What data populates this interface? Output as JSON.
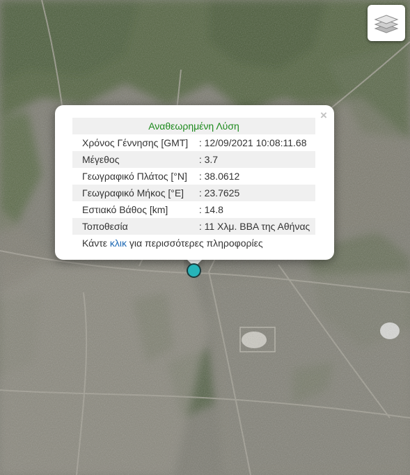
{
  "map": {
    "layers_control": {
      "icon": "layers-icon"
    }
  },
  "popup": {
    "title": "Αναθεωρημένη Λύση",
    "close_label": "×",
    "rows": [
      {
        "label": "Χρόνος Γέννησης [GMT]",
        "value": ": 12/09/2021 10:08:11.68"
      },
      {
        "label": "Μέγεθος",
        "value": ": 3.7"
      },
      {
        "label": "Γεωγραφικό Πλάτος [°N]",
        "value": ": 38.0612"
      },
      {
        "label": "Γεωγραφικό Μήκος [°E]",
        "value": ": 23.7625"
      },
      {
        "label": "Εστιακό Βάθος [km]",
        "value": ": 14.8"
      },
      {
        "label": "Τοποθεσία",
        "value": ": 11 Χλμ. ΒΒΑ της Αθήνας"
      }
    ],
    "more_prefix": "Κάντε ",
    "more_link": "κλικ",
    "more_suffix": " για περισσότερες πληροφορίες"
  },
  "marker": {
    "color": "#27b4b9"
  },
  "colors": {
    "title_green": "#1c8a1c",
    "link_blue": "#1c68b4"
  }
}
